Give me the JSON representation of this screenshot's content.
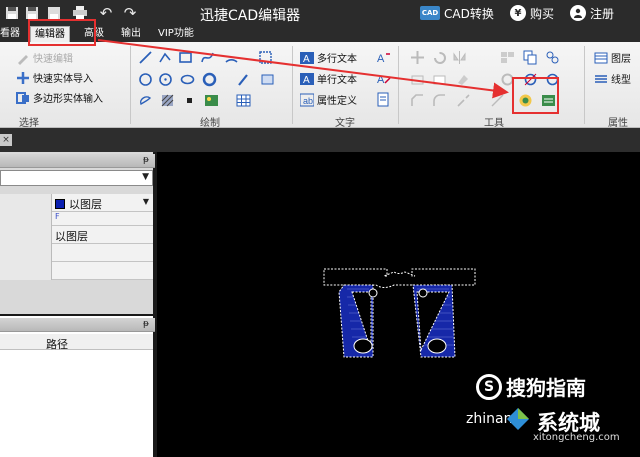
{
  "titlebar": {
    "title": "迅捷CAD编辑器",
    "cad_badge": "CAD",
    "convert_label": "CAD转换",
    "buy_icon_glyph": "¥",
    "buy_label": "购买",
    "register_label": "注册"
  },
  "menu": {
    "tabs": [
      "看器",
      "编辑器",
      "高级",
      "输出",
      "VIP功能"
    ],
    "active": "编辑器"
  },
  "ribbon": {
    "select_group": {
      "label": "选择",
      "items": [
        "快速编辑",
        "快速实体导入",
        "多边形实体输入"
      ]
    },
    "draw_group": {
      "label": "绘制"
    },
    "text_group": {
      "label": "文字",
      "items": [
        "多行文本",
        "单行文本",
        "属性定义"
      ]
    },
    "tools_group": {
      "label": "工具"
    },
    "right_group": {
      "label": "属性",
      "items": [
        "图层",
        "线型"
      ]
    }
  },
  "left_panel": {
    "tab_close": "×",
    "pin_glyph": "ᵽ",
    "combo_arrow": "▼",
    "layer_value": "以图层",
    "small_value": "F",
    "layer_value_2": "以图层"
  },
  "layers_panel": {
    "pin_glyph": "ᵽ",
    "path_header": "路径"
  },
  "watermark": {
    "line1": "搜狗指南",
    "line2": "zhinan",
    "line3": "系统城",
    "line4": "xitongcheng.com"
  },
  "colors": {
    "highlight": "#e53030",
    "canvas_bg": "#000000",
    "shape_fill": "#1628a8"
  }
}
